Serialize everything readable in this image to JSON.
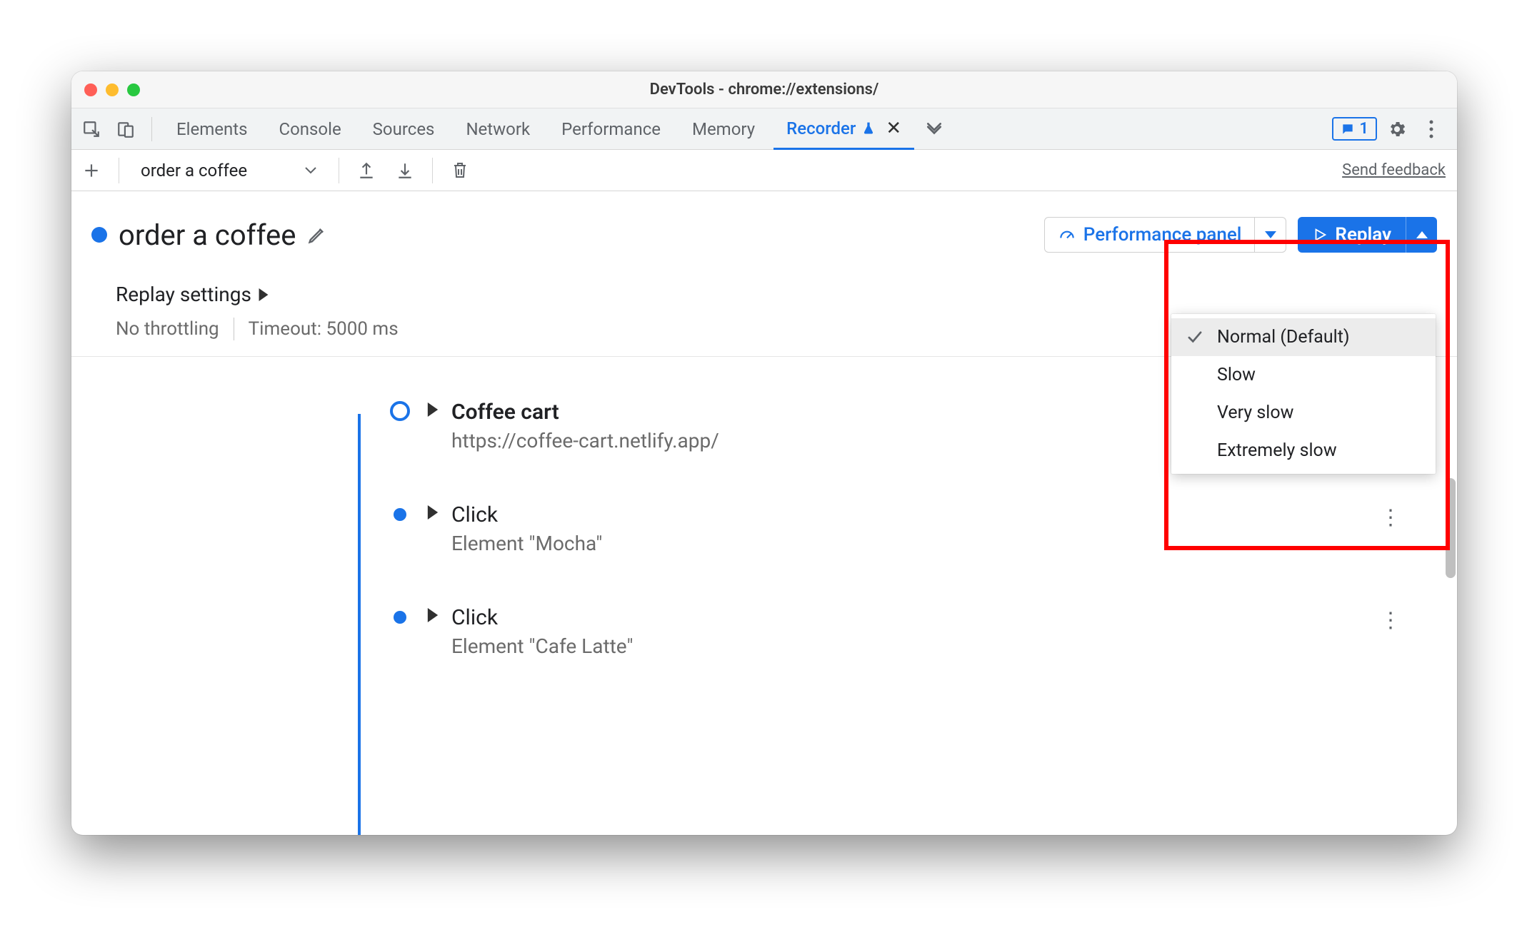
{
  "window": {
    "title": "DevTools - chrome://extensions/"
  },
  "tabs": {
    "items": [
      "Elements",
      "Console",
      "Sources",
      "Network",
      "Performance",
      "Memory"
    ],
    "activeTab": "Recorder",
    "issuesCount": "1"
  },
  "toolbar": {
    "recordingName": "order a coffee",
    "feedback": "Send feedback"
  },
  "recording": {
    "title": "order a coffee",
    "performancePanel": "Performance panel",
    "replayLabel": "Replay"
  },
  "replaySettings": {
    "heading": "Replay settings",
    "throttling": "No throttling",
    "timeout": "Timeout: 5000 ms"
  },
  "speedMenu": {
    "items": [
      {
        "label": "Normal (Default)",
        "selected": true
      },
      {
        "label": "Slow",
        "selected": false
      },
      {
        "label": "Very slow",
        "selected": false
      },
      {
        "label": "Extremely slow",
        "selected": false
      }
    ]
  },
  "steps": [
    {
      "name": "Coffee cart",
      "detail": "https://coffee-cart.netlify.app/",
      "bold": true,
      "start": true
    },
    {
      "name": "Click",
      "detail": "Element \"Mocha\"",
      "bold": false,
      "start": false
    },
    {
      "name": "Click",
      "detail": "Element \"Cafe Latte\"",
      "bold": false,
      "start": false
    }
  ]
}
